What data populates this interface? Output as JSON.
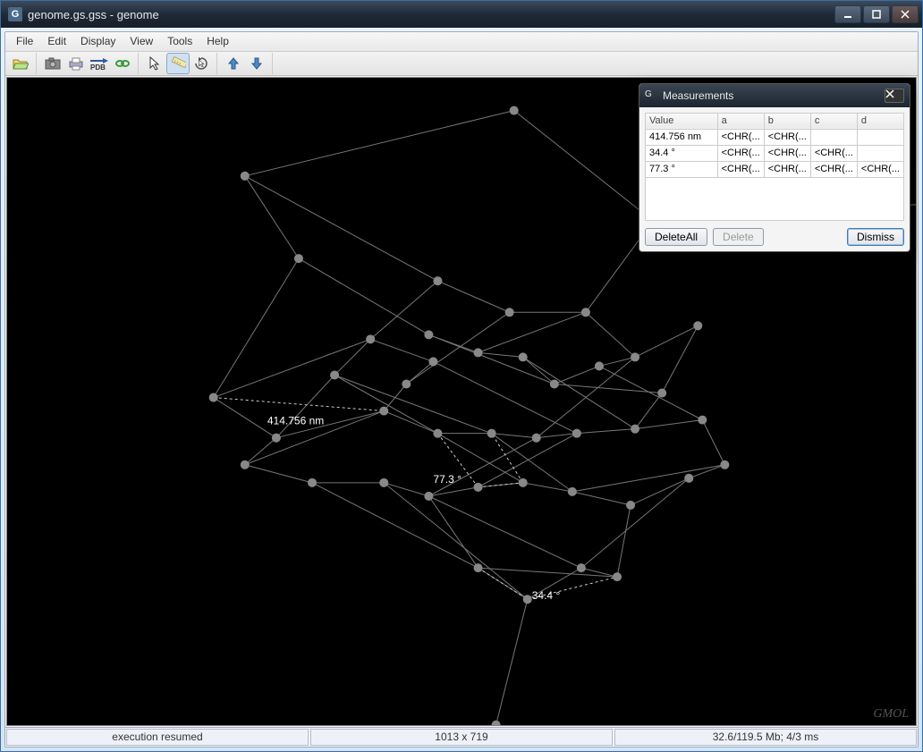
{
  "window": {
    "title": "genome.gs.gss - genome",
    "icon_letter": "G"
  },
  "menu": [
    "File",
    "Edit",
    "Display",
    "View",
    "Tools",
    "Help"
  ],
  "toolbar": {
    "open": "open-icon",
    "save": "save-icon",
    "print": "print-icon",
    "pdb": "PDB",
    "link": "chain-icon",
    "pointer": "pointer-icon",
    "ruler": "ruler-icon",
    "rotate": "rotate-icon",
    "up": "up-arrow-icon",
    "down": "down-arrow-icon"
  },
  "canvas": {
    "watermark": "GMOL",
    "labels": {
      "distance": "414.756 nm",
      "angle1": "77.3 °",
      "angle2": "34.4 °"
    }
  },
  "measurements": {
    "title": "Measurements",
    "columns": [
      "Value",
      "a",
      "b",
      "c",
      "d"
    ],
    "rows": [
      {
        "value": "414.756 nm",
        "a": "<CHR(...",
        "b": "<CHR(...",
        "c": "",
        "d": ""
      },
      {
        "value": "34.4 °",
        "a": "<CHR(...",
        "b": "<CHR(...",
        "c": "<CHR(...",
        "d": ""
      },
      {
        "value": "77.3 °",
        "a": "<CHR(...",
        "b": "<CHR(...",
        "c": "<CHR(...",
        "d": "<CHR(..."
      }
    ],
    "buttons": {
      "delete_all": "DeleteAll",
      "delete": "Delete",
      "dismiss": "Dismiss"
    }
  },
  "status": {
    "left": "execution resumed",
    "center": "1013 x 719",
    "right": "32.6/119.5 Mb;   4/3 ms"
  }
}
